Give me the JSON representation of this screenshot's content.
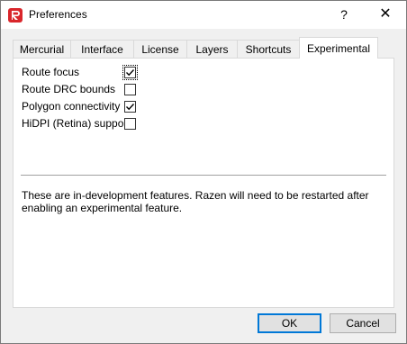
{
  "window": {
    "title": "Preferences",
    "help_glyph": "?",
    "close_glyph": "✕"
  },
  "tabs": [
    {
      "label": "Mercurial"
    },
    {
      "label": "Interface"
    },
    {
      "label": "License"
    },
    {
      "label": "Layers"
    },
    {
      "label": "Shortcuts"
    },
    {
      "label": "Experimental"
    }
  ],
  "active_tab": "Experimental",
  "options": [
    {
      "label": "Route focus",
      "checked": true
    },
    {
      "label": "Route DRC bounds",
      "checked": false
    },
    {
      "label": "Polygon connectivity",
      "checked": true
    },
    {
      "label": "HiDPI (Retina) support",
      "checked": false
    }
  ],
  "note": "These are in-development features. Razen will need to be restarted after enabling an experimental feature.",
  "buttons": {
    "ok": "OK",
    "cancel": "Cancel"
  },
  "colors": {
    "accent": "#0078d7",
    "logo": "#d9262b"
  },
  "icons": {
    "app": "razen-logo-icon",
    "check": "checkmark-icon"
  }
}
